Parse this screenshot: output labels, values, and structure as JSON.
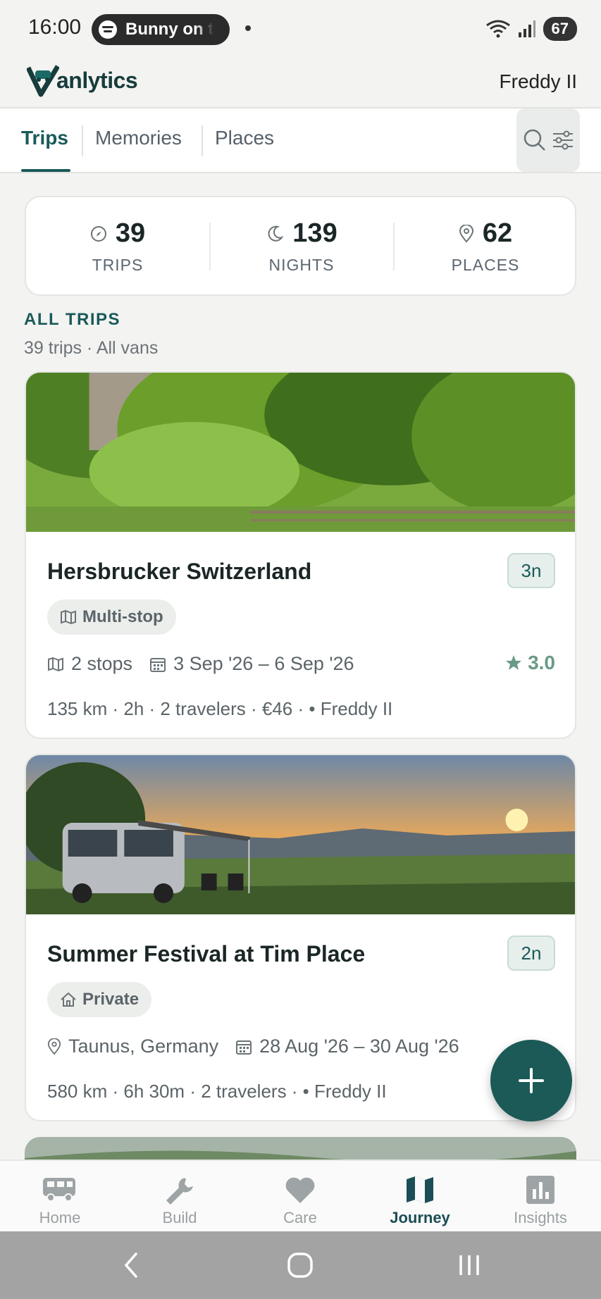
{
  "status_bar": {
    "time": "16:00",
    "media_text": "Bunny on t",
    "battery": "67"
  },
  "header": {
    "logo_text": "anlytics",
    "user_name": "Freddy II"
  },
  "tabs": [
    {
      "label": "Trips",
      "active": true
    },
    {
      "label": "Memories",
      "active": false
    },
    {
      "label": "Places",
      "active": false
    }
  ],
  "stats": [
    {
      "icon": "compass-icon",
      "value": "39",
      "label": "TRIPS"
    },
    {
      "icon": "moon-icon",
      "value": "139",
      "label": "NIGHTS"
    },
    {
      "icon": "location-pin-icon",
      "value": "62",
      "label": "PLACES"
    }
  ],
  "section": {
    "title": "ALL TRIPS",
    "subtitle": "39 trips · All vans"
  },
  "trips": [
    {
      "title": "Hersbrucker Switzerland",
      "nights": "3n",
      "type": "Multi-stop",
      "type_icon": "map-icon",
      "location_or_stops": "2 stops",
      "location_icon": "map-icon",
      "dates": "3 Sep '26 – 6 Sep '26",
      "rating": "3.0",
      "details": "135 km · 2h · 2 travelers · €46 · • Freddy II"
    },
    {
      "title": "Summer Festival at Tim Place",
      "nights": "2n",
      "type": "Private",
      "type_icon": "home-icon",
      "location_or_stops": "Taunus, Germany",
      "location_icon": "location-pin-icon",
      "dates": "28 Aug '26 – 30 Aug '26",
      "rating": "",
      "details": "580 km · 6h 30m · 2 travelers · • Freddy II"
    }
  ],
  "bottom_nav": [
    {
      "label": "Home",
      "icon": "van-icon",
      "active": false
    },
    {
      "label": "Build",
      "icon": "wrench-icon",
      "active": false
    },
    {
      "label": "Care",
      "icon": "heart-icon",
      "active": false
    },
    {
      "label": "Journey",
      "icon": "map-icon",
      "active": true
    },
    {
      "label": "Insights",
      "icon": "bar-chart-icon",
      "active": false
    }
  ],
  "colors": {
    "accent": "#1a5a5a",
    "fab": "#1b5a56",
    "rating": "#6a9a86",
    "background": "#f3f3f1"
  }
}
